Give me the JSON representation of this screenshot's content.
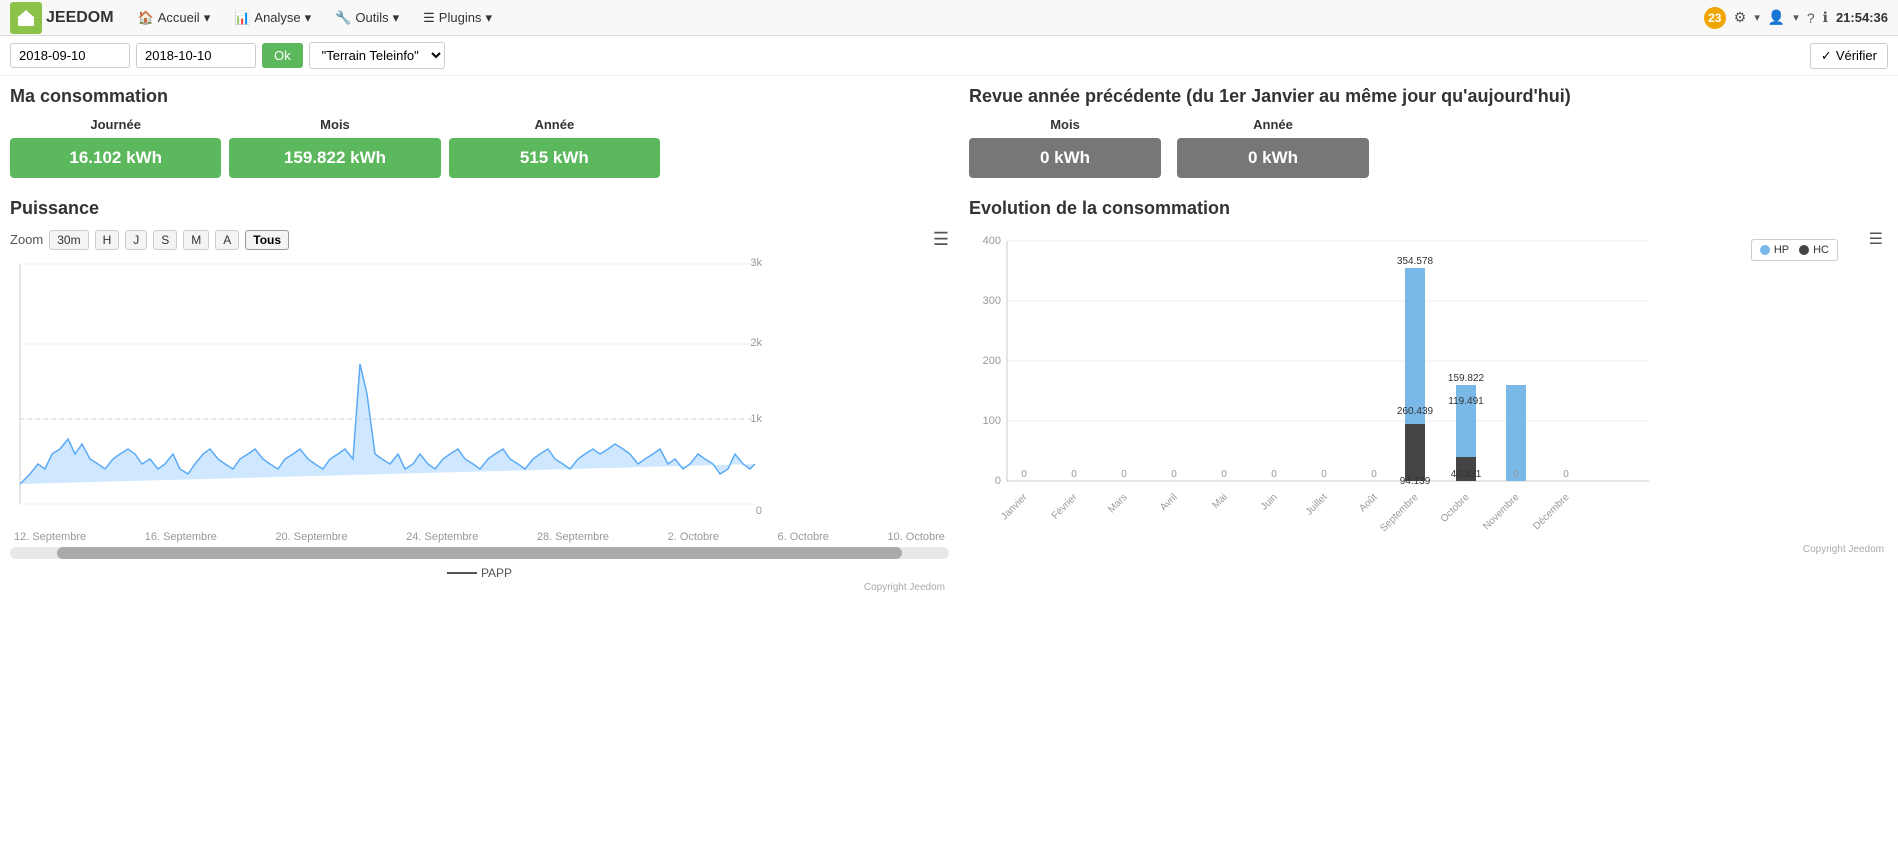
{
  "nav": {
    "brand": "JEEDOM",
    "items": [
      {
        "label": "Accueil",
        "icon": "home"
      },
      {
        "label": "Analyse",
        "icon": "chart"
      },
      {
        "label": "Outils",
        "icon": "wrench"
      },
      {
        "label": "Plugins",
        "icon": "puzzle"
      }
    ],
    "badge": "23",
    "time": "21:54:36"
  },
  "toolbar": {
    "date_from": "2018-09-10",
    "date_to": "2018-10-10",
    "ok_label": "Ok",
    "device": "\"Terrain Teleinfo\"",
    "verify_label": "Vérifier"
  },
  "consommation": {
    "title": "Ma consommation",
    "items": [
      {
        "label": "Journée",
        "value": "16.102 kWh",
        "color": "green"
      },
      {
        "label": "Mois",
        "value": "159.822 kWh",
        "color": "green"
      },
      {
        "label": "Année",
        "value": "515 kWh",
        "color": "green"
      }
    ]
  },
  "revue": {
    "title": "Revue année précédente (du 1er Janvier au même jour qu'aujourd'hui)",
    "items": [
      {
        "label": "Mois",
        "value": "0 kWh",
        "color": "gray"
      },
      {
        "label": "Année",
        "value": "0 kWh",
        "color": "gray"
      }
    ]
  },
  "puissance": {
    "title": "Puissance",
    "zoom_label": "Zoom",
    "zoom_buttons": [
      "30m",
      "H",
      "J",
      "S",
      "M",
      "A",
      "Tous"
    ],
    "zoom_active": "Tous",
    "y_labels": [
      "3k",
      "2k",
      "0"
    ],
    "x_labels": [
      "12. Septembre",
      "16. Septembre",
      "20. Septembre",
      "24. Septembre",
      "28. Septembre",
      "2. Octobre",
      "6. Octobre",
      "10. Octobre"
    ],
    "legend": "PAPP",
    "copyright": "Copyright Jeedom"
  },
  "evolution": {
    "title": "Evolution de la consommation",
    "y_labels": [
      "400",
      "300",
      "200",
      "100",
      "0"
    ],
    "x_labels": [
      "Janvier",
      "Février",
      "Mars",
      "Avril",
      "Mai",
      "Juin",
      "Juillet",
      "Août",
      "Septembre",
      "Octobre",
      "Novembre",
      "Décembre"
    ],
    "hp_label": "HP",
    "hc_label": "HC",
    "bars": [
      {
        "month": "Janvier",
        "hp": 0,
        "hc": 0
      },
      {
        "month": "Février",
        "hp": 0,
        "hc": 0
      },
      {
        "month": "Mars",
        "hp": 0,
        "hc": 0
      },
      {
        "month": "Avril",
        "hp": 0,
        "hc": 0
      },
      {
        "month": "Mai",
        "hp": 0,
        "hc": 0
      },
      {
        "month": "Juin",
        "hp": 0,
        "hc": 0
      },
      {
        "month": "Juillet",
        "hp": 0,
        "hc": 0
      },
      {
        "month": "Août",
        "hp": 0,
        "hc": 0
      },
      {
        "month": "Septembre",
        "hp": 354.578,
        "hc": 94.139
      },
      {
        "month": "Octobre",
        "hp": 119.491,
        "hc": 40.331
      },
      {
        "month": "Novembre",
        "hp": 159.822,
        "hc": 0
      },
      {
        "month": "Décembre",
        "hp": 0,
        "hc": 0
      }
    ],
    "bar_labels": {
      "sep_hp": "354.578",
      "sep_hc": "94.139",
      "sep_hp2": "260.439",
      "oct_hp": "119.491",
      "oct_hc": "40.331",
      "oct_total": "159.822",
      "nov_hp": "159.822"
    },
    "copyright": "Copyright Jeedom"
  }
}
